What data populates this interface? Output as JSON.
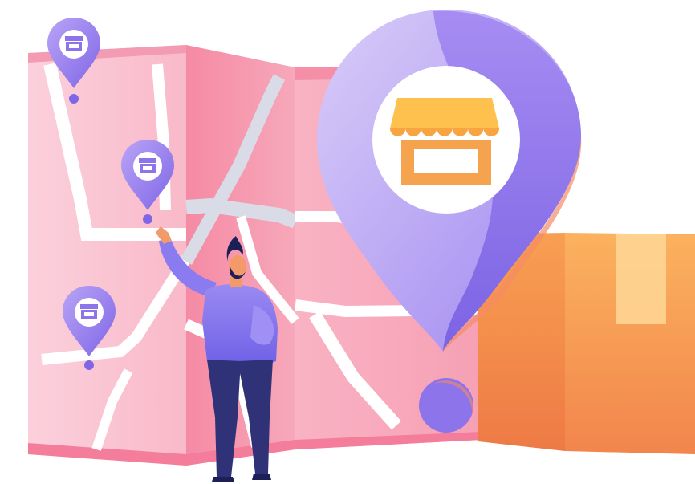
{
  "illustration": {
    "subject": "store-locator-map",
    "colors": {
      "background": "#ffffff",
      "map_pink": "#f7a1b3",
      "map_pink_light": "#fbcad6",
      "map_pink_dark": "#f07f9c",
      "road": "#ffffff",
      "road_grey": "#d7dbe4",
      "pin_purple_light": "#c7b6f5",
      "pin_purple": "#9b82f0",
      "pin_purple_dark": "#7f66e6",
      "store_orange": "#f6a34f",
      "store_yellow": "#ffc14d",
      "box_orange": "#f9a55a",
      "box_orange_dark": "#f28a4c",
      "box_tape": "#ffd796",
      "person_shirt": "#8474ee",
      "person_pants": "#2f3277",
      "person_hair": "#1c2056",
      "person_skin": "#f39a6b"
    },
    "icons": [
      "store-icon",
      "map-pin-icon"
    ]
  }
}
